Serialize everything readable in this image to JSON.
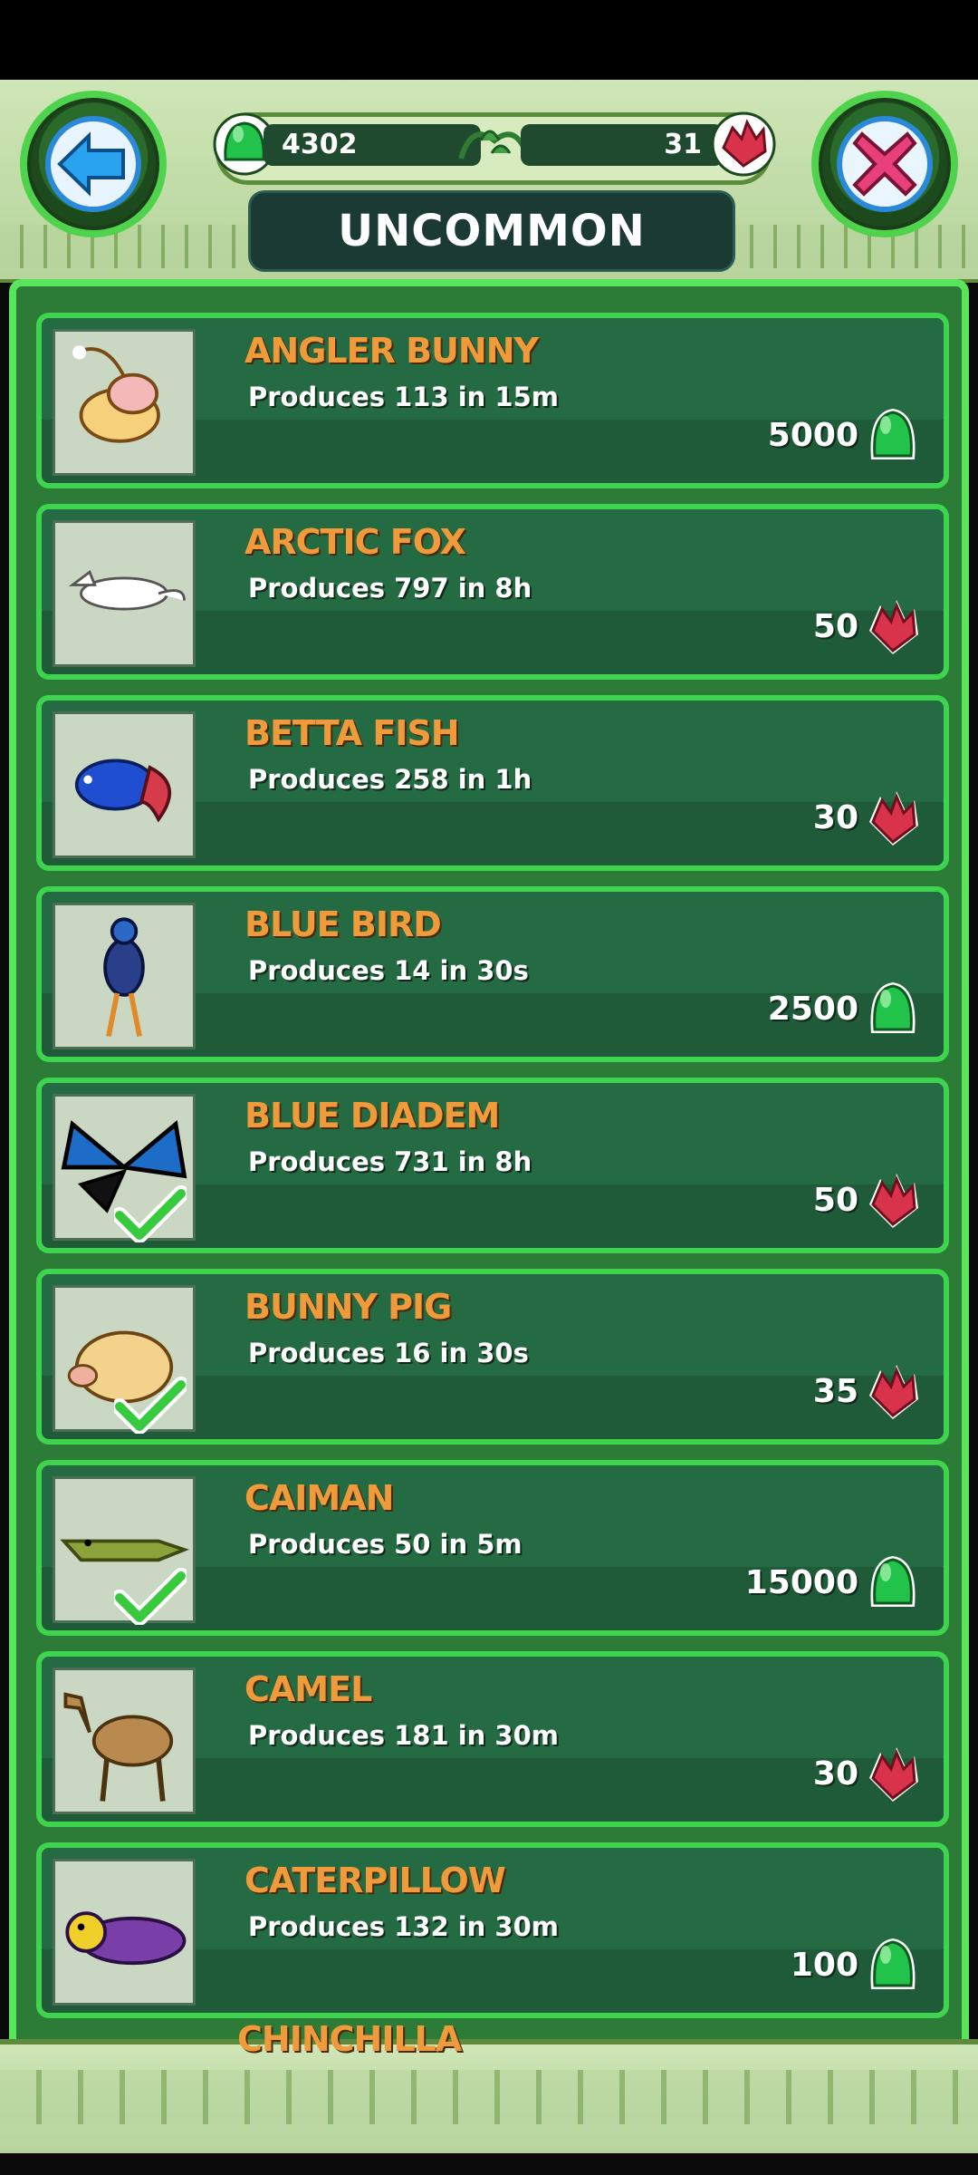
{
  "header": {
    "title": "UNCOMMON",
    "jelly_count": "4302",
    "gem_count": "31"
  },
  "colors": {
    "card_border": "#3ed44d",
    "card_bg": "#1f5a39",
    "name_text": "#ef9b3c",
    "jelly_green": "#22c34a",
    "gem_red": "#d8334b"
  },
  "items": [
    {
      "name": "ANGLER BUNNY",
      "produces": "Produces 113 in 15m",
      "price": "5000",
      "currency": "jelly-icon",
      "owned": false
    },
    {
      "name": "ARCTIC FOX",
      "produces": "Produces 797 in 8h",
      "price": "50",
      "currency": "gem-icon",
      "owned": false
    },
    {
      "name": "BETTA FISH",
      "produces": "Produces 258 in 1h",
      "price": "30",
      "currency": "gem-icon",
      "owned": false
    },
    {
      "name": "BLUE BIRD",
      "produces": "Produces 14 in 30s",
      "price": "2500",
      "currency": "jelly-icon",
      "owned": false
    },
    {
      "name": "BLUE DIADEM",
      "produces": "Produces 731 in 8h",
      "price": "50",
      "currency": "gem-icon",
      "owned": true
    },
    {
      "name": "BUNNY PIG",
      "produces": "Produces 16 in 30s",
      "price": "35",
      "currency": "gem-icon",
      "owned": true
    },
    {
      "name": "CAIMAN",
      "produces": "Produces 50 in 5m",
      "price": "15000",
      "currency": "jelly-icon",
      "owned": true
    },
    {
      "name": "CAMEL",
      "produces": "Produces 181 in 30m",
      "price": "30",
      "currency": "gem-icon",
      "owned": false
    },
    {
      "name": "CATERPILLOW",
      "produces": "Produces 132 in 30m",
      "price": "100",
      "currency": "jelly-icon",
      "owned": false
    }
  ],
  "peek_item": {
    "name": "CHINCHILLA"
  }
}
